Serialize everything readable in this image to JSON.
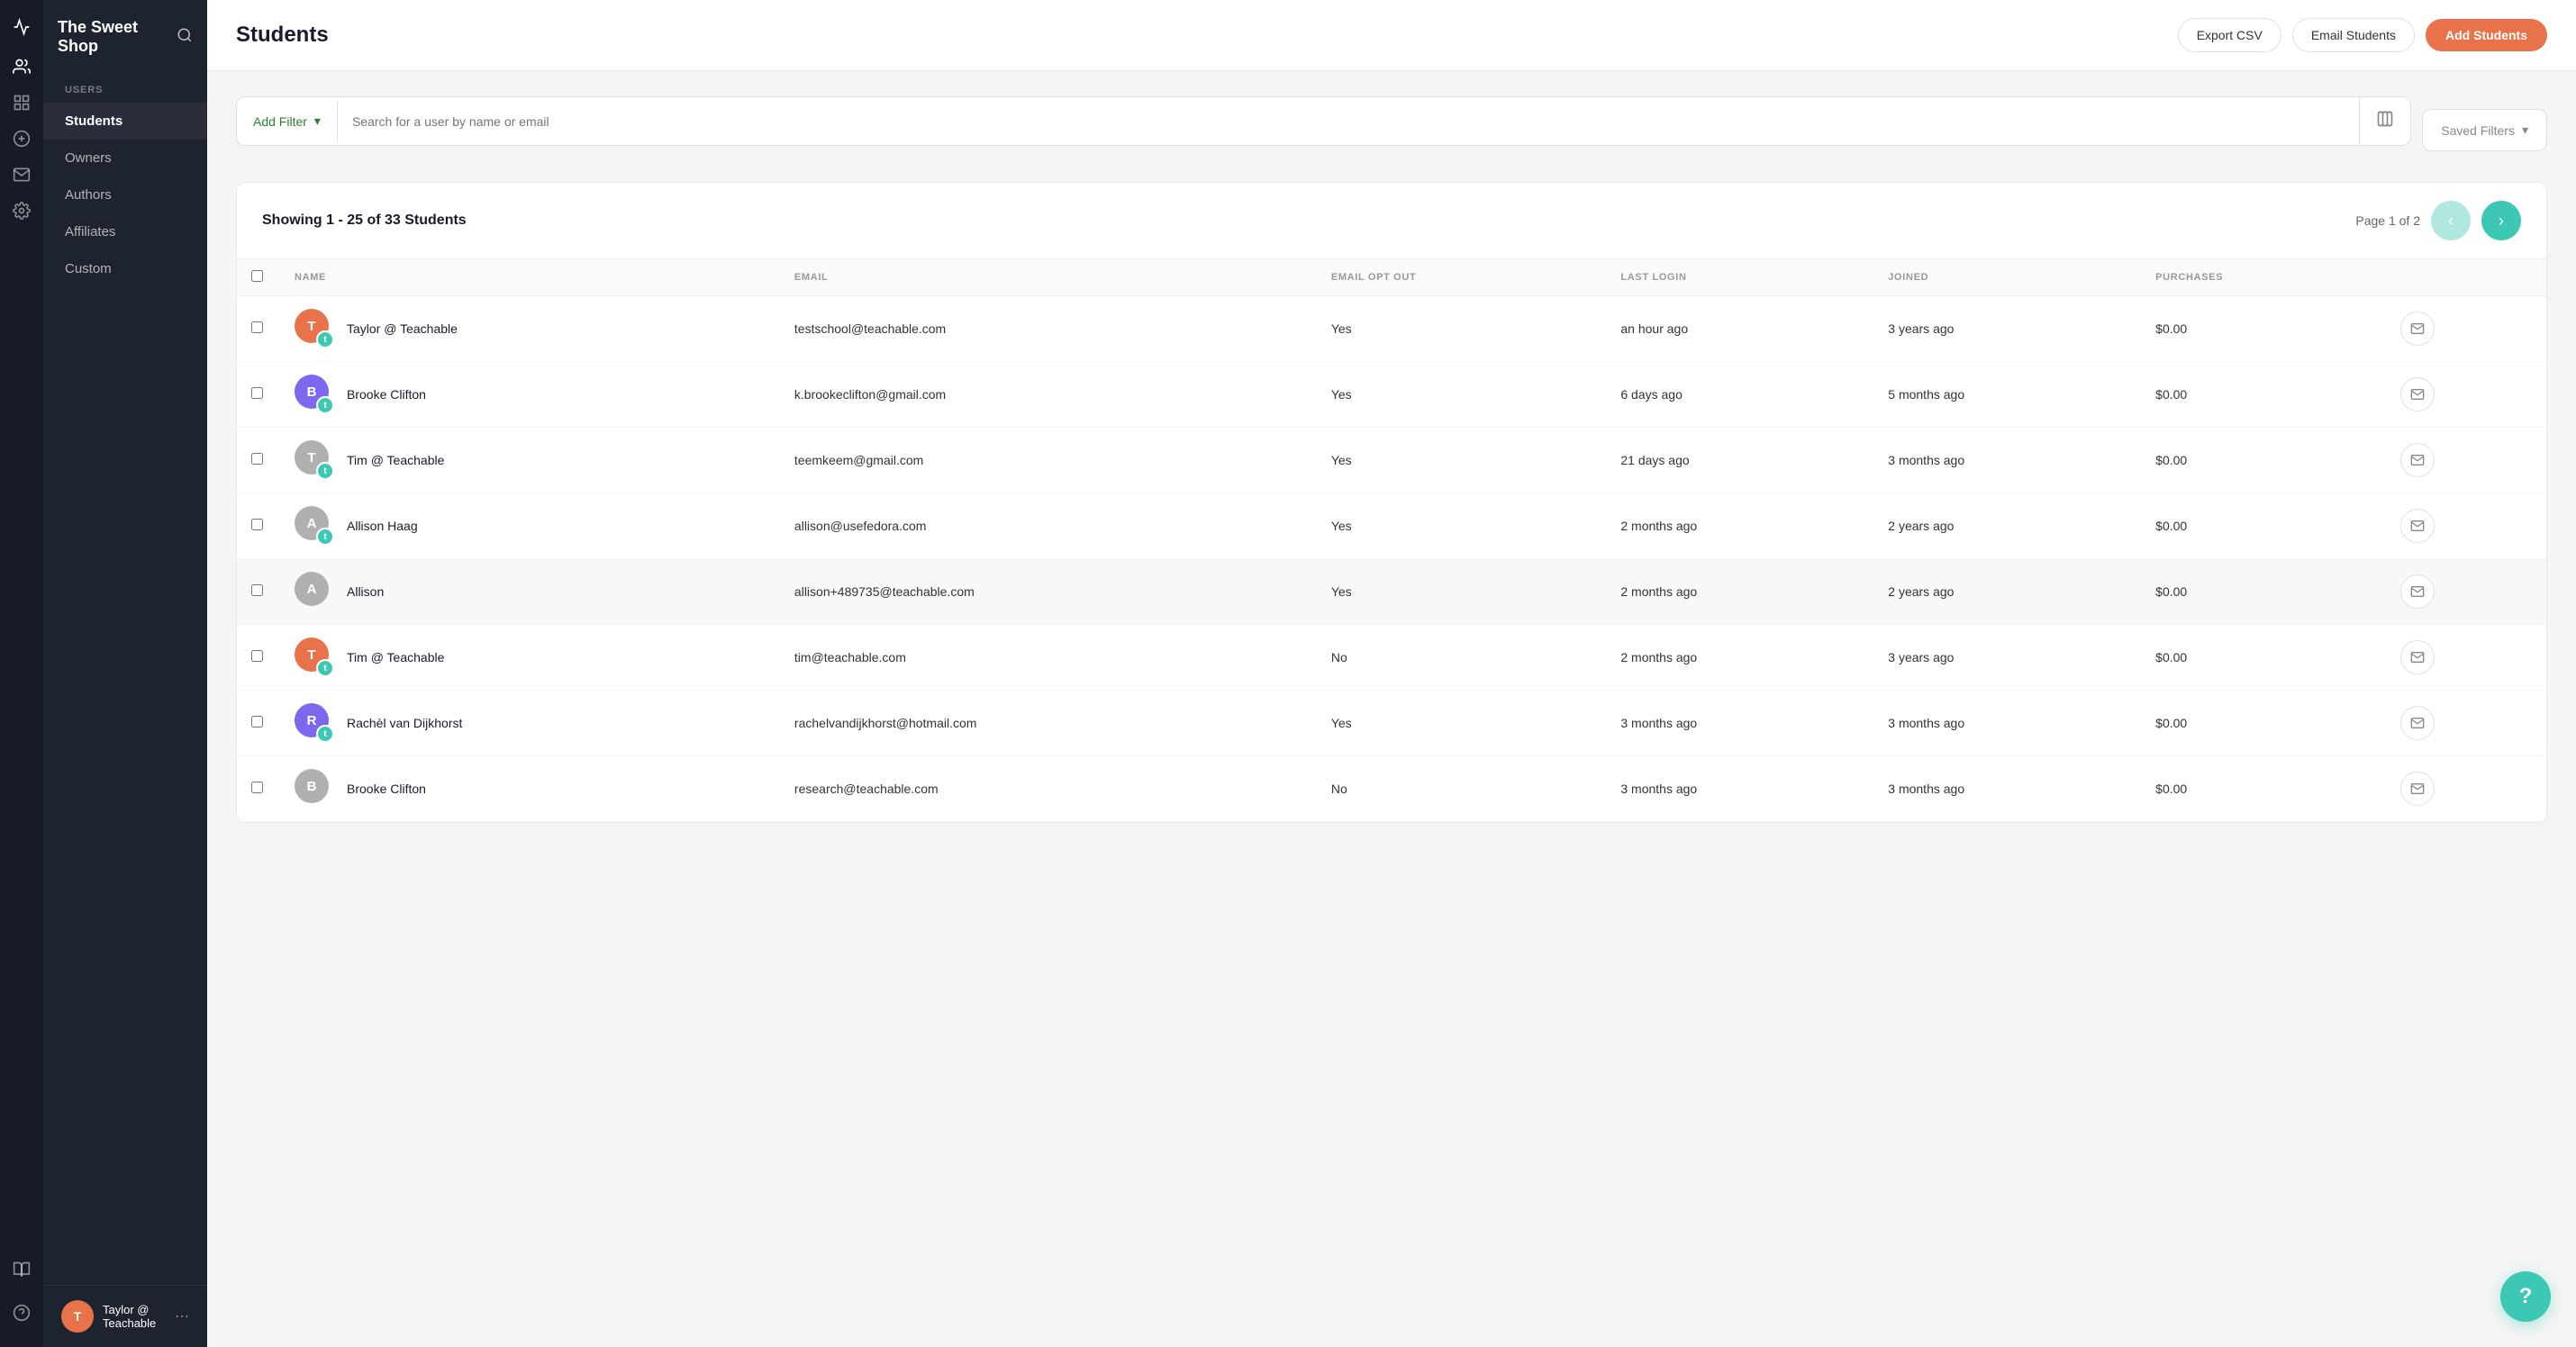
{
  "sidebar": {
    "logo": "The Sweet Shop",
    "search_icon": "🔍",
    "nav_sections": [
      {
        "label": "USERS",
        "items": [
          {
            "id": "students",
            "label": "Students",
            "active": true
          },
          {
            "id": "owners",
            "label": "Owners",
            "active": false
          },
          {
            "id": "authors",
            "label": "Authors",
            "active": false
          },
          {
            "id": "affiliates",
            "label": "Affiliates",
            "active": false
          },
          {
            "id": "custom",
            "label": "Custom",
            "active": false
          }
        ]
      }
    ],
    "icons": [
      {
        "id": "activity",
        "symbol": "📈"
      },
      {
        "id": "users",
        "symbol": "👤"
      },
      {
        "id": "dashboard",
        "symbol": "⊞"
      },
      {
        "id": "billing",
        "symbol": "💲"
      },
      {
        "id": "mail",
        "symbol": "✉"
      },
      {
        "id": "settings",
        "symbol": "⚙"
      },
      {
        "id": "library",
        "symbol": "▦"
      },
      {
        "id": "help",
        "symbol": "?"
      }
    ],
    "current_user": {
      "name": "Taylor @ Teachable",
      "initials": "T",
      "avatar_color": "#e8734a"
    }
  },
  "header": {
    "title": "Students",
    "export_csv_label": "Export CSV",
    "email_students_label": "Email Students",
    "add_students_label": "Add Students"
  },
  "filter_bar": {
    "add_filter_label": "Add Filter",
    "search_placeholder": "Search for a user by name or email",
    "saved_filters_label": "Saved Filters"
  },
  "table": {
    "showing_text": "Showing 1 - 25 of 33 Students",
    "page_label": "Page 1 of 2",
    "columns": [
      {
        "id": "name",
        "label": "NAME"
      },
      {
        "id": "email",
        "label": "EMAIL"
      },
      {
        "id": "email_opt_out",
        "label": "EMAIL OPT OUT"
      },
      {
        "id": "last_login",
        "label": "LAST LOGIN"
      },
      {
        "id": "joined",
        "label": "JOINED"
      },
      {
        "id": "purchases",
        "label": "PURCHASES"
      },
      {
        "id": "actions",
        "label": ""
      }
    ],
    "rows": [
      {
        "id": 1,
        "name": "Taylor @ Teachable",
        "email": "testschool@teachable.com",
        "email_opt_out": "Yes",
        "last_login": "an hour ago",
        "joined": "3 years ago",
        "purchases": "$0.00",
        "avatar_text": "T",
        "avatar_color": "#e8734a",
        "has_badge": true,
        "highlighted": false
      },
      {
        "id": 2,
        "name": "Brooke Clifton",
        "email": "k.brookeclifton@gmail.com",
        "email_opt_out": "Yes",
        "last_login": "6 days ago",
        "joined": "5 months ago",
        "purchases": "$0.00",
        "avatar_text": "B",
        "avatar_color": "#7b68ee",
        "has_badge": true,
        "highlighted": false
      },
      {
        "id": 3,
        "name": "Tim @ Teachable",
        "email": "teemkeem@gmail.com",
        "email_opt_out": "Yes",
        "last_login": "21 days ago",
        "joined": "3 months ago",
        "purchases": "$0.00",
        "avatar_text": "T",
        "avatar_color": "#b0b0b0",
        "has_badge": true,
        "highlighted": false
      },
      {
        "id": 4,
        "name": "Allison Haag",
        "email": "allison@usefedora.com",
        "email_opt_out": "Yes",
        "last_login": "2 months ago",
        "joined": "2 years ago",
        "purchases": "$0.00",
        "avatar_text": "A",
        "avatar_color": "#b0b0b0",
        "has_badge": true,
        "highlighted": false
      },
      {
        "id": 5,
        "name": "Allison",
        "email": "allison+489735@teachable.com",
        "email_opt_out": "Yes",
        "last_login": "2 months ago",
        "joined": "2 years ago",
        "purchases": "$0.00",
        "avatar_text": "A",
        "avatar_color": "#b0b0b0",
        "has_badge": false,
        "highlighted": true
      },
      {
        "id": 6,
        "name": "Tim @ Teachable",
        "email": "tim@teachable.com",
        "email_opt_out": "No",
        "last_login": "2 months ago",
        "joined": "3 years ago",
        "purchases": "$0.00",
        "avatar_text": "T",
        "avatar_color": "#e8734a",
        "has_badge": true,
        "highlighted": false
      },
      {
        "id": 7,
        "name": "Rachèl van Dijkhorst",
        "email": "rachelvandijkhorst@hotmail.com",
        "email_opt_out": "Yes",
        "last_login": "3 months ago",
        "joined": "3 months ago",
        "purchases": "$0.00",
        "avatar_text": "R",
        "avatar_color": "#7b68ee",
        "has_badge": true,
        "highlighted": false
      },
      {
        "id": 8,
        "name": "Brooke Clifton",
        "email": "research@teachable.com",
        "email_opt_out": "No",
        "last_login": "3 months ago",
        "joined": "3 months ago",
        "purchases": "$0.00",
        "avatar_text": "B",
        "avatar_color": "#b0b0b0",
        "has_badge": false,
        "highlighted": false
      }
    ]
  },
  "help_button_label": "?"
}
